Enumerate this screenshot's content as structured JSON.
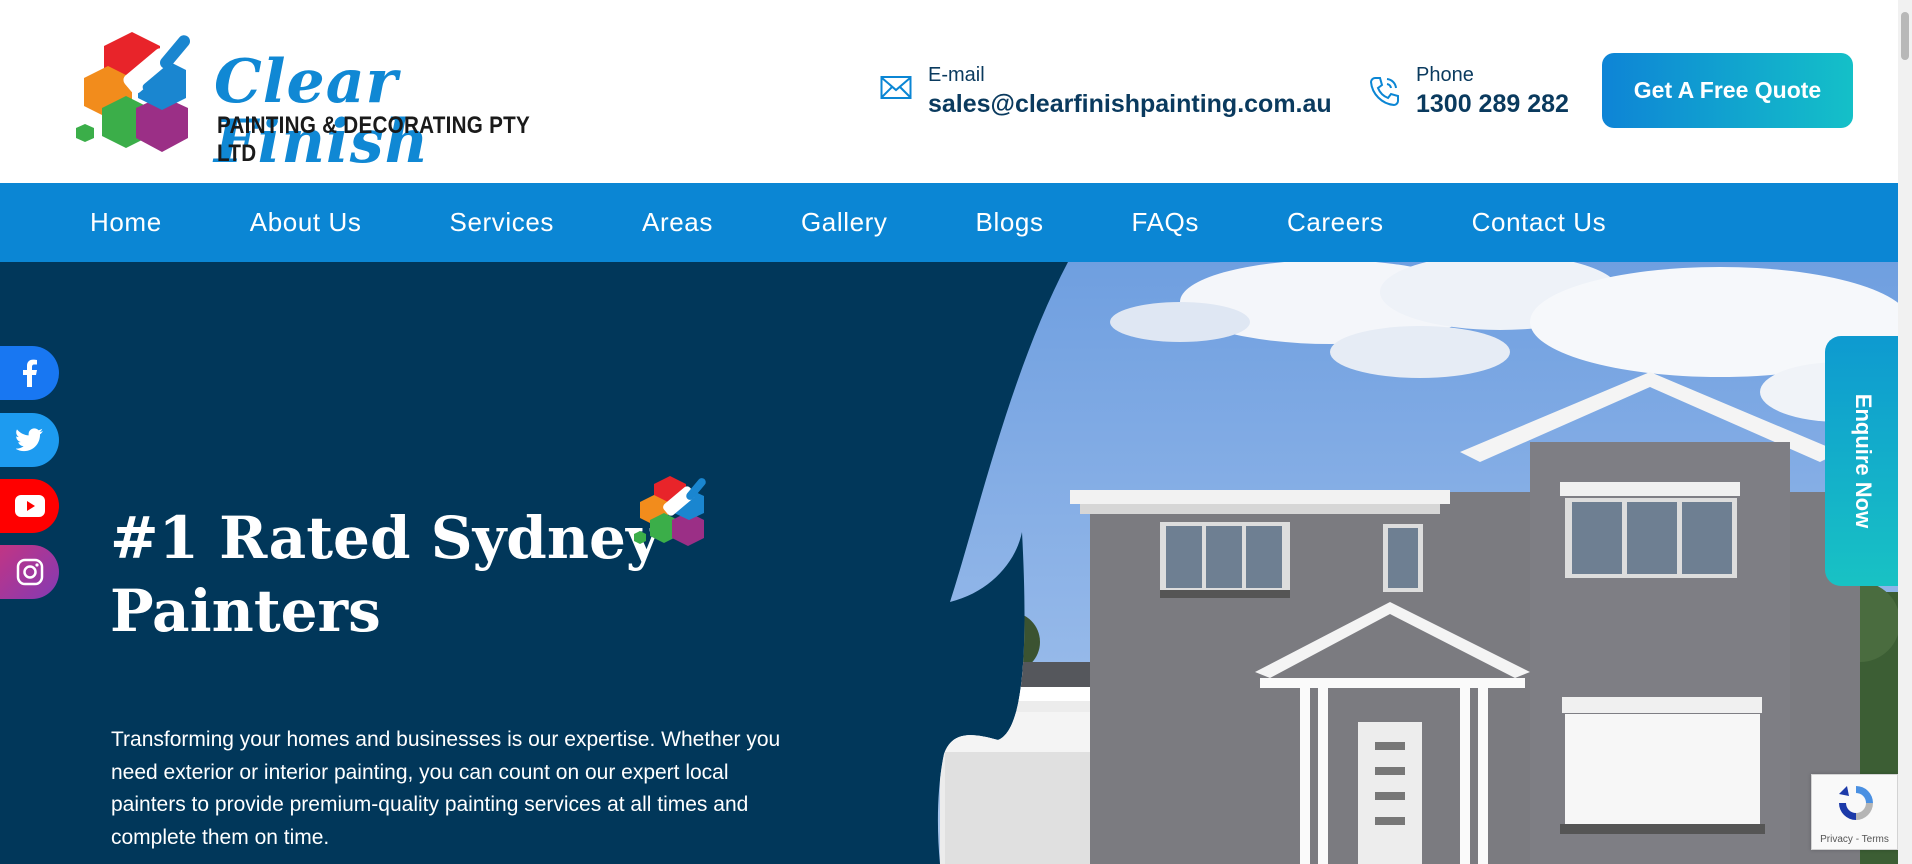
{
  "brand": {
    "name": "Clear Finish",
    "tagline": "PAINTING & DECORATING PTY LTD"
  },
  "contact": {
    "email_label": "E-mail",
    "email_value": "sales@clearfinishpainting.com.au",
    "phone_label": "Phone",
    "phone_value": "1300 289 282"
  },
  "header": {
    "cta_label": "Get A Free Quote"
  },
  "nav": {
    "items": [
      {
        "label": "Home"
      },
      {
        "label": "About Us"
      },
      {
        "label": "Services"
      },
      {
        "label": "Areas"
      },
      {
        "label": "Gallery"
      },
      {
        "label": "Blogs"
      },
      {
        "label": "FAQs"
      },
      {
        "label": "Careers"
      },
      {
        "label": "Contact Us"
      }
    ]
  },
  "hero": {
    "title": "#1 Rated Sydney Painters",
    "description": "Transforming your homes and businesses is our expertise. Whether you need exterior or interior painting, you can count on our expert local painters to provide premium-quality painting services at all times and complete them on time."
  },
  "social": {
    "items": [
      {
        "name": "facebook",
        "icon": "facebook-icon",
        "color": "#1877f2"
      },
      {
        "name": "twitter",
        "icon": "twitter-icon",
        "color": "#1d9bf0"
      },
      {
        "name": "youtube",
        "icon": "youtube-icon",
        "color": "#ff0000"
      },
      {
        "name": "instagram",
        "icon": "instagram-icon",
        "color": "#c13584"
      }
    ]
  },
  "enquire": {
    "label": "Enquire Now"
  },
  "recaptcha": {
    "text": "Privacy - Terms"
  },
  "colors": {
    "brand_blue": "#0b86d4",
    "hero_navy": "#01375a",
    "text_navy": "#0a3a5e",
    "cta_gradient_start": "#0e84d6",
    "cta_gradient_end": "#14c0c8"
  }
}
